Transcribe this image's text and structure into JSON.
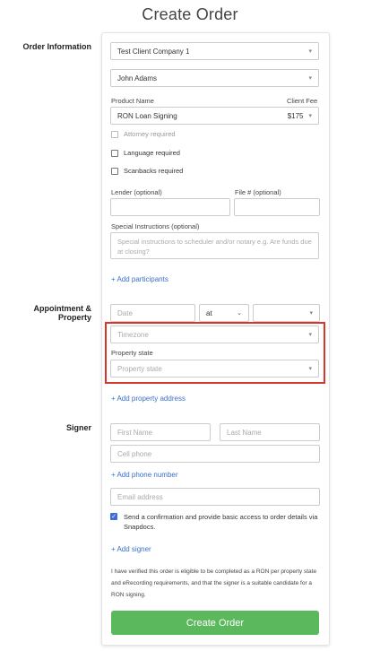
{
  "page": {
    "title": "Create Order"
  },
  "sections": {
    "order_information": "Order Information",
    "appointment_property": "Appointment & Property",
    "signer": "Signer"
  },
  "order": {
    "client_company": "Test Client Company 1",
    "contact": "John Adams",
    "product_name_label": "Product Name",
    "client_fee_label": "Client Fee",
    "product_name": "RON Loan Signing",
    "client_fee": "$175",
    "checkboxes": [
      {
        "label": "Attorney required",
        "checked": false,
        "disabled": true
      },
      {
        "label": "Language required",
        "checked": false,
        "disabled": false
      },
      {
        "label": "Scanbacks required",
        "checked": false,
        "disabled": false
      }
    ],
    "lender_label": "Lender (optional)",
    "file_label": "File # (optional)",
    "special_instructions_label": "Special Instructions (optional)",
    "special_instructions_placeholder": "Special instructions to scheduler and/or notary e.g. Are funds due at closing?",
    "add_participants": "+ Add participants"
  },
  "appointment": {
    "date_placeholder": "Date",
    "at_value": "at",
    "timezone_placeholder": "Timezone",
    "property_state_label": "Property state",
    "property_state_placeholder": "Property state",
    "add_property_address": "+ Add property address"
  },
  "signer": {
    "first_name_placeholder": "First Name",
    "last_name_placeholder": "Last Name",
    "cell_phone_placeholder": "Cell phone",
    "add_phone_number": "+ Add phone number",
    "email_placeholder": "Email address",
    "confirmation_label": "Send a confirmation and provide basic access to order details via Snapdocs.",
    "confirmation_checked": true,
    "add_signer": "+ Add signer"
  },
  "footer": {
    "verification_text": "I have verified this order is eligible to be completed as a RON per property state and eRecording requirements, and that the signer is a suitable candidate for a RON signing.",
    "submit_label": "Create Order"
  },
  "colors": {
    "accent_link": "#3a6fc9",
    "primary_button": "#5cb85c",
    "highlight_border": "#d9362b",
    "checkbox_checked": "#3b6fd8"
  }
}
